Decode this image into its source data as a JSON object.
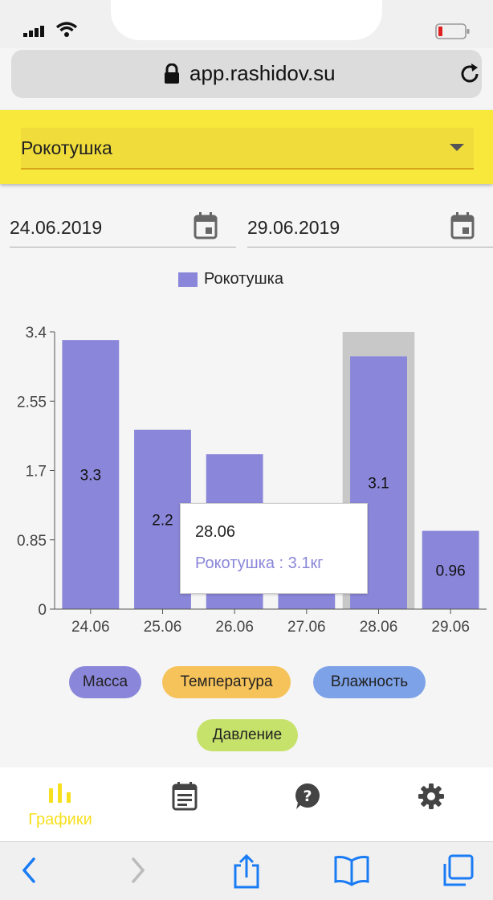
{
  "browser": {
    "url": "app.rashidov.su"
  },
  "header": {
    "selected_animal": "Рокотушка"
  },
  "dates": {
    "from": "24.06.2019",
    "to": "29.06.2019"
  },
  "chart_data": {
    "type": "bar",
    "categories": [
      "24.06",
      "25.06",
      "26.06",
      "27.06",
      "28.06",
      "29.06"
    ],
    "series": [
      {
        "name": "Рокотушка",
        "values": [
          3.3,
          2.2,
          1.9,
          1.3,
          3.1,
          0.96
        ]
      }
    ],
    "data_labels": [
      "3.3",
      "2.2",
      "",
      "",
      "3.1",
      "0.96"
    ],
    "y_ticks": [
      "0",
      "0.85",
      "1.7",
      "2.55",
      "3.4"
    ],
    "ylim": [
      0,
      3.4
    ],
    "highlighted_category": "28.06",
    "bar_color": "#8a86d9",
    "highlight_color": "#c8c8c8",
    "legend_position": "top-center"
  },
  "tooltip": {
    "title": "28.06",
    "value": "Рокотушка : 3.1кг"
  },
  "metrics": {
    "mass": "Масса",
    "temperature": "Температура",
    "humidity": "Влажность",
    "pressure": "Давление"
  },
  "bottom_nav": {
    "graphs_label": "Графики",
    "active_color": "#f7e020"
  },
  "colors": {
    "header": "#f7e83b",
    "mass": "#8a86d9",
    "temperature": "#f6c25a",
    "humidity": "#7da2e8",
    "pressure": "#c6e26a"
  }
}
